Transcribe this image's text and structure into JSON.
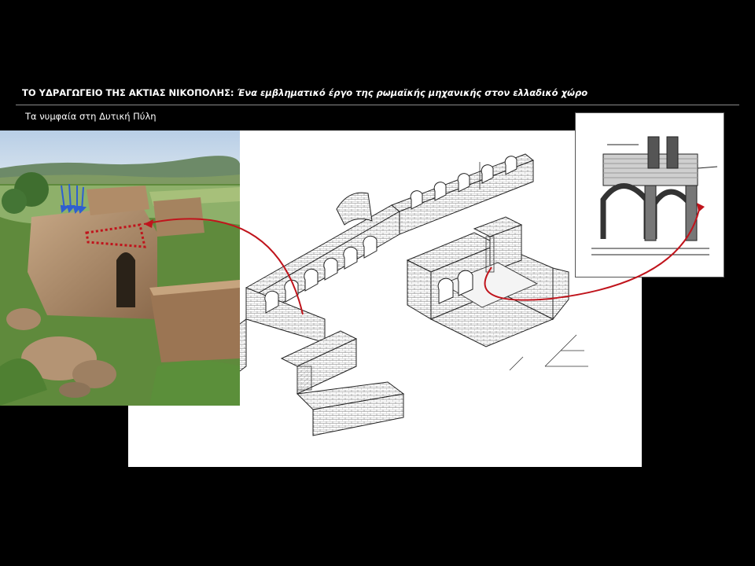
{
  "slide": {
    "title_main": "ΤΟ ΥΔΡΑΓΩΓΕΙΟ ΤΗΣ ΑΚΤΙΑΣ ΝΙΚΟΠΟΛΗΣ:",
    "title_sub": " Ένα εμβληματικό έργο της ρωμαϊκής μηχανικής στον ελλαδικό χώρο",
    "subtitle": "Τα νυμφαία στη Δυτική Πύλη"
  },
  "colors": {
    "background": "#000000",
    "annotation_red": "#c0141c",
    "water_arrows": "#2f5fd0"
  },
  "images": {
    "photo": "photo-of-ruins",
    "plan": "axonometric-plan-drawing",
    "section": "section-drawing"
  }
}
